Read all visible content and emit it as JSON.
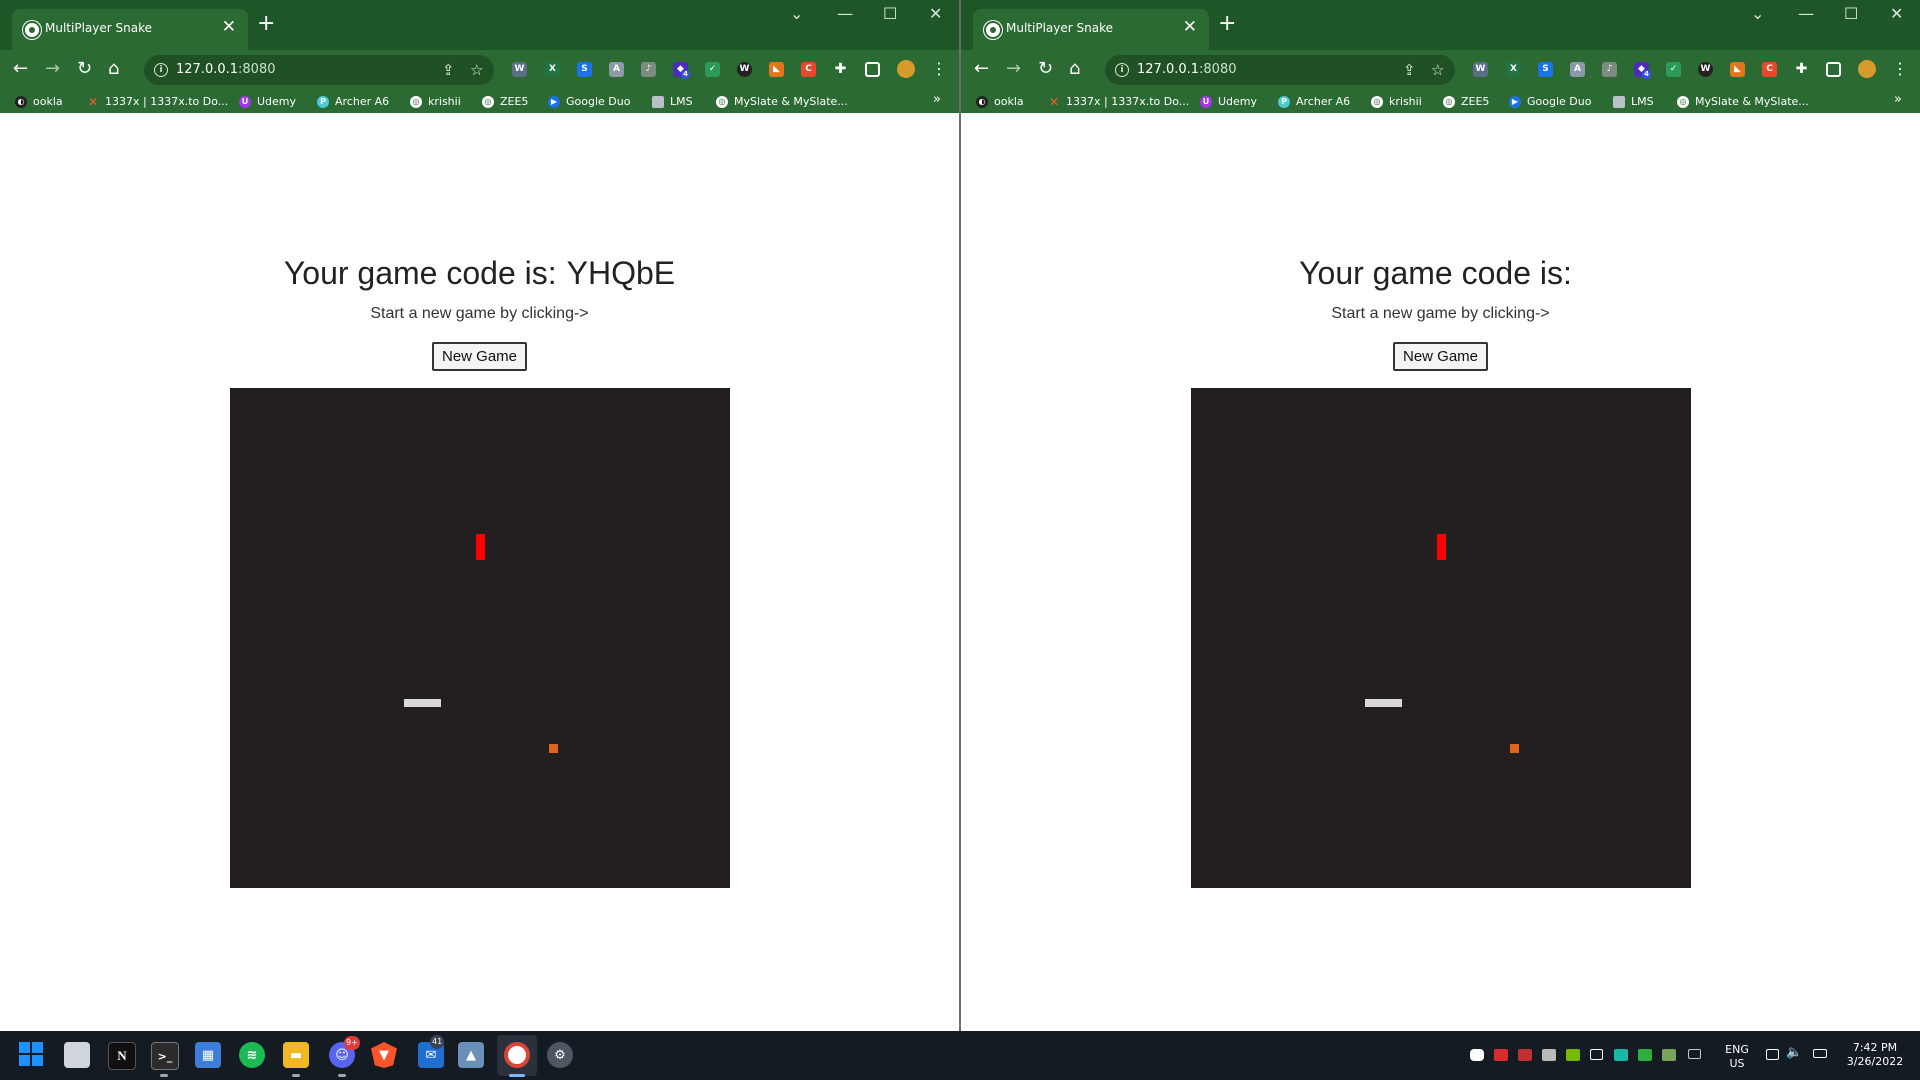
{
  "browsers": [
    {
      "tab_title": "MultiPlayer Snake",
      "url_host": "127.0.0.1",
      "url_port": ":8080",
      "game_title": "Your game code is:",
      "game_code": "YHQbE",
      "subtitle": "Start a new game by clicking->",
      "button_label": "New Game"
    },
    {
      "tab_title": "MultiPlayer Snake",
      "url_host": "127.0.0.1",
      "url_port": ":8080",
      "game_title": "Your game code is:",
      "game_code": "",
      "subtitle": "Start a new game by clicking->",
      "button_label": "New Game"
    }
  ],
  "bookmarks": [
    "ookla",
    "1337x | 1337x.to Do...",
    "Udemy",
    "Archer A6",
    "krishii",
    "ZEE5",
    "Google Duo",
    "LMS",
    "MySlate & MySlate..."
  ],
  "extensions_badge": "4",
  "taskbar": {
    "discord_badge": "9+",
    "mail_badge": "41",
    "language_line1": "ENG",
    "language_line2": "US",
    "time": "7:42 PM",
    "date": "3/26/2022"
  },
  "colors": {
    "frame": "#1e5628",
    "toolbar": "#2b6a33",
    "canvas": "#231f20",
    "snake_red": "#ff0000",
    "snake_gray": "#d8d8d8",
    "food": "#e0651f"
  }
}
